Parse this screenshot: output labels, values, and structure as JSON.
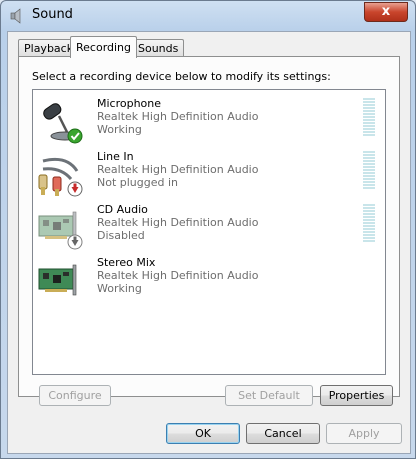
{
  "window": {
    "title": "Sound",
    "close_glyph": "x"
  },
  "tabs": [
    {
      "label": "Playback",
      "active": false
    },
    {
      "label": "Recording",
      "active": true
    },
    {
      "label": "Sounds",
      "active": false
    }
  ],
  "instruction": "Select a recording device below to modify its settings:",
  "devices": [
    {
      "name": "Microphone",
      "description": "Realtek High Definition Audio",
      "status": "Working",
      "icon": "microphone-icon",
      "badge": "green-check-badge",
      "meter_level": 0
    },
    {
      "name": "Line In",
      "description": "Realtek High Definition Audio",
      "status": "Not plugged in",
      "icon": "rca-cable-icon",
      "badge": "red-down-arrow-badge",
      "meter_level": 0
    },
    {
      "name": "CD Audio",
      "description": "Realtek High Definition Audio",
      "status": "Disabled",
      "icon": "sound-card-icon",
      "badge": "down-arrow-badge",
      "meter_level": 0
    },
    {
      "name": "Stereo Mix",
      "description": "Realtek High Definition Audio",
      "status": "Working",
      "icon": "sound-card-icon",
      "badge": "",
      "meter_level": 0
    }
  ],
  "buttons": {
    "configure": "Configure",
    "set_default": "Set Default",
    "properties": "Properties",
    "ok": "OK",
    "cancel": "Cancel",
    "apply": "Apply"
  },
  "colors": {
    "meter_idle": "#c9e5ea",
    "status_text": "#6d6d6d",
    "check_badge": "#3aa52f",
    "red_badge": "#c62b2b"
  }
}
